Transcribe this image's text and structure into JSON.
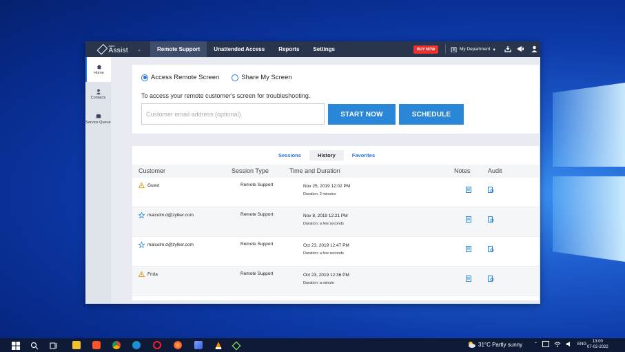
{
  "app": {
    "logo_small": "Zoho",
    "logo_big": "Assist",
    "nav": [
      "Remote Support",
      "Unattended Access",
      "Reports",
      "Settings"
    ],
    "active_nav": "Remote Support",
    "buy_now": "BUY NOW",
    "department": "My Department"
  },
  "sidebar": {
    "items": [
      {
        "label": "Home",
        "icon": "home-icon"
      },
      {
        "label": "Contacts",
        "icon": "contacts-icon"
      },
      {
        "label": "Service Queue",
        "icon": "service-queue-icon"
      }
    ]
  },
  "session": {
    "option_access": "Access Remote Screen",
    "option_share": "Share My Screen",
    "selected": "Access Remote Screen",
    "description": "To access your remote customer's screen for troubleshooting.",
    "email_placeholder": "Customer email address (optional)",
    "email_value": "",
    "start_label": "START NOW",
    "schedule_label": "SCHEDULE"
  },
  "history": {
    "tabs": [
      "Sessions",
      "History",
      "Favorites"
    ],
    "active_tab": "History",
    "columns": [
      "Customer",
      "Session Type",
      "Time and Duration",
      "Notes",
      "Audit"
    ],
    "rows": [
      {
        "customer": "Guest",
        "icon": "warning-icon",
        "type": "Remote Support",
        "date": "Nov 25, 2019 12:02 PM",
        "duration": "Duration: 2 minutes"
      },
      {
        "customer": "malcolm.d@zylker.com",
        "icon": "star-icon",
        "type": "Remote Support",
        "date": "Nov 8, 2019 12:21 PM",
        "duration": "Duration: a few seconds"
      },
      {
        "customer": "malcolm.d@zylker.com",
        "icon": "star-icon",
        "type": "Remote Support",
        "date": "Oct 23, 2019 12:47 PM",
        "duration": "Duration: a few seconds"
      },
      {
        "customer": "Frida",
        "icon": "warning-icon",
        "type": "Remote Support",
        "date": "Oct 23, 2019 12:36 PM",
        "duration": "Duration: a minute"
      }
    ]
  },
  "taskbar": {
    "weather": "31°C  Partly sunny",
    "language": "ENG",
    "time": "13:00",
    "date": "07-02-2022"
  },
  "colors": {
    "accent": "#2a87d8",
    "topbar": "#28354c",
    "buy_now": "#e83232",
    "warning": "#f0a020"
  }
}
